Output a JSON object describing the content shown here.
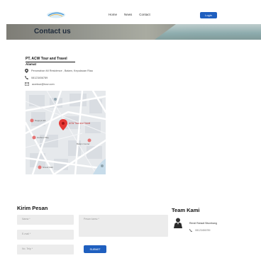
{
  "header": {
    "logo_text": "ACW",
    "nav": [
      "Home",
      "News",
      "Contact"
    ],
    "login_label": "Login"
  },
  "banner": {
    "title": "Contact us"
  },
  "company": {
    "name": "PT. ACW Tour and Travel",
    "address_label": "Alamat",
    "address": "Perumahan Mi Residence , Batam, Kepulauan Riau",
    "phone": "08123456789",
    "email": "acwtour@tour.com"
  },
  "map": {
    "pin_label": "ACW Tour and Travel",
    "places": [
      "Nagoya Hill",
      "Harbour Bay",
      "Batam Center",
      "Grand Mall"
    ]
  },
  "contact_form": {
    "title": "Kirim Pesan",
    "name_placeholder": "Nama *",
    "message_placeholder": "Pesan kamu *",
    "email_placeholder": "E-mail *",
    "phone_placeholder": "No. Telp *",
    "submit_label": "SUBMIT"
  },
  "team": {
    "title": "Team Kami",
    "members": [
      {
        "name": "Rendi Rahadi Situmbang",
        "phone": "08123456789"
      }
    ]
  },
  "colors": {
    "accent": "#1f5fbf"
  }
}
